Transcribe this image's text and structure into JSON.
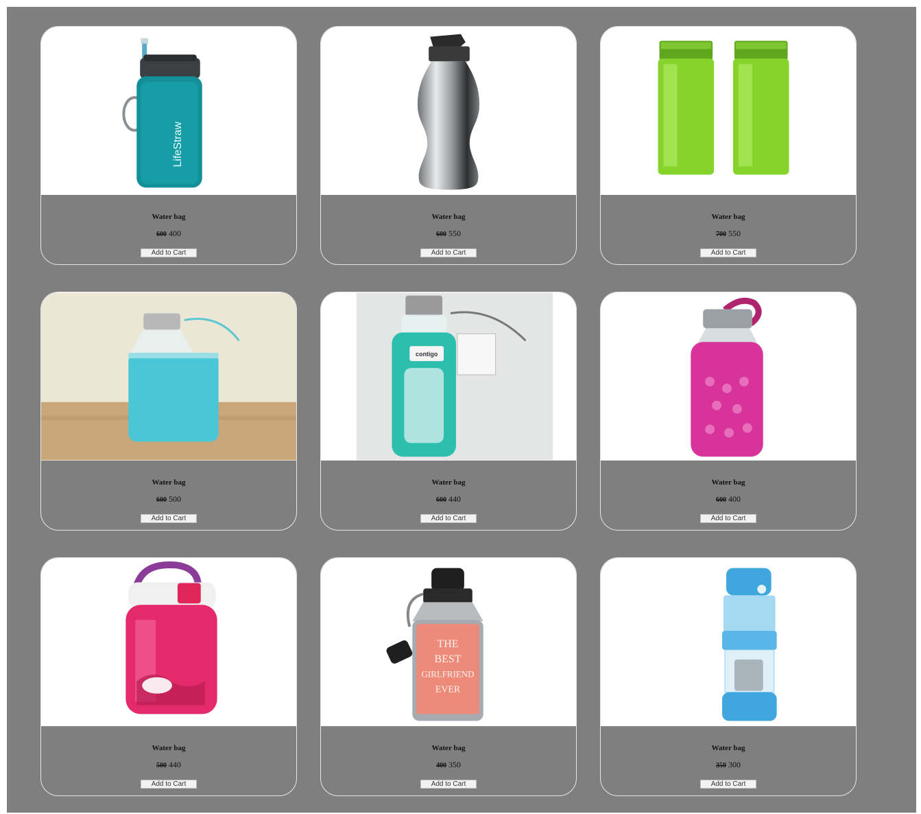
{
  "products": [
    {
      "name": "Water bag",
      "old_price": "600",
      "price": "400",
      "button": "Add to Cart"
    },
    {
      "name": "Water bag",
      "old_price": "600",
      "price": "550",
      "button": "Add to Cart"
    },
    {
      "name": "Water bag",
      "old_price": "700",
      "price": "550",
      "button": "Add to Cart"
    },
    {
      "name": "Water bag",
      "old_price": "600",
      "price": "500",
      "button": "Add to Cart"
    },
    {
      "name": "Water bag",
      "old_price": "600",
      "price": "440",
      "button": "Add to Cart"
    },
    {
      "name": "Water bag",
      "old_price": "600",
      "price": "400",
      "button": "Add to Cart"
    },
    {
      "name": "Water bag",
      "old_price": "500",
      "price": "440",
      "button": "Add to Cart"
    },
    {
      "name": "Water bag",
      "old_price": "400",
      "price": "350",
      "button": "Add to Cart"
    },
    {
      "name": "Water bag",
      "old_price": "350",
      "price": "300",
      "button": "Add to Cart"
    }
  ],
  "image_text": {
    "lifestraw": "LifeStraw",
    "contigo": "contigo",
    "best": [
      "THE",
      "BEST",
      "GIRLFRIEND",
      "EVER"
    ]
  },
  "colors": {
    "page_bg": "#7f7f7f",
    "card_border": "#e6e6e6",
    "image_bg": "#ffffff"
  }
}
